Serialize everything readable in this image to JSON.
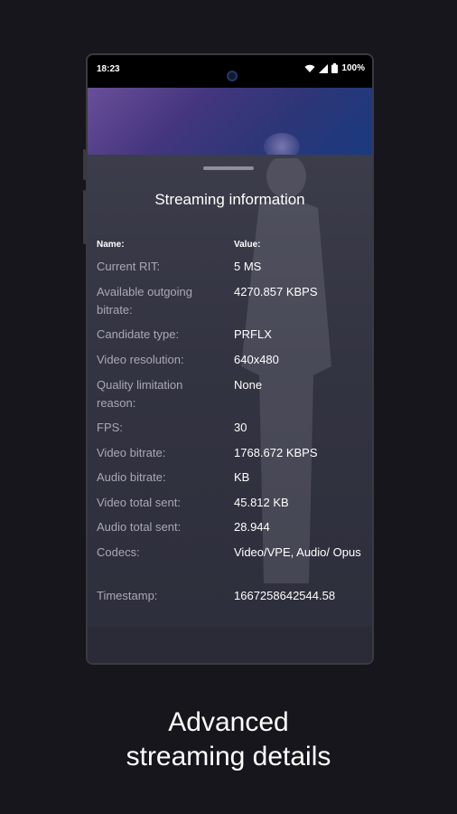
{
  "statusbar": {
    "time": "18:23",
    "battery": "100%",
    "icons": [
      "wifi-icon",
      "signal-icon",
      "battery-icon"
    ]
  },
  "sheet": {
    "title": "Streaming information",
    "header": {
      "name": "Name:",
      "value": "Value:"
    },
    "rows": [
      {
        "label": "Current RIT:",
        "value": "5 MS"
      },
      {
        "label": "Available outgoing bitrate:",
        "value": "4270.857 KBPS"
      },
      {
        "label": "Candidate type:",
        "value": "PRFLX"
      },
      {
        "label": "Video resolution:",
        "value": "640x480"
      },
      {
        "label": "Quality limitation reason:",
        "value": "None"
      },
      {
        "label": "FPS:",
        "value": "30"
      },
      {
        "label": "Video bitrate:",
        "value": "1768.672 KBPS"
      },
      {
        "label": "Audio bitrate:",
        "value": "KB"
      },
      {
        "label": "Video total sent:",
        "value": "45.812 KB"
      },
      {
        "label": "Audio total sent:",
        "value": "28.944"
      },
      {
        "label": "Codecs:",
        "value": "Video/VPE, Audio/ Opus"
      },
      {
        "label": "Timestamp:",
        "value": "1667258642544.58"
      }
    ]
  },
  "caption": {
    "line1": "Advanced",
    "line2": "streaming details"
  }
}
